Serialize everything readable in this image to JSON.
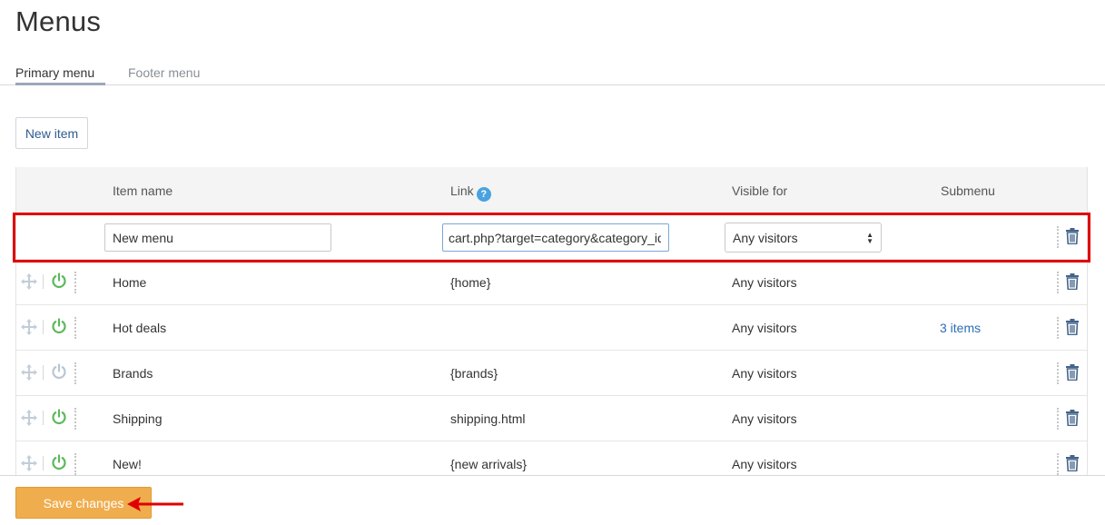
{
  "page": {
    "title": "Menus"
  },
  "tabs": [
    {
      "label": "Primary menu",
      "active": true
    },
    {
      "label": "Footer menu",
      "active": false
    }
  ],
  "toolbar": {
    "new_item_label": "New item"
  },
  "table": {
    "headers": {
      "item_name": "Item name",
      "link": "Link",
      "visible_for": "Visible for",
      "submenu": "Submenu"
    },
    "edit_row": {
      "name_value": "New menu",
      "link_value": "cart.php?target=category&category_id=",
      "visible_for": "Any visitors"
    },
    "rows": [
      {
        "name": "Home",
        "link": "{home}",
        "visible_for": "Any visitors",
        "submenu": "",
        "enabled": true
      },
      {
        "name": "Hot deals",
        "link": "",
        "visible_for": "Any visitors",
        "submenu": "3 items",
        "enabled": true
      },
      {
        "name": "Brands",
        "link": "{brands}",
        "visible_for": "Any visitors",
        "submenu": "",
        "enabled": false
      },
      {
        "name": "Shipping",
        "link": "shipping.html",
        "visible_for": "Any visitors",
        "submenu": "",
        "enabled": true
      },
      {
        "name": "New!",
        "link": "{new arrivals}",
        "visible_for": "Any visitors",
        "submenu": "",
        "enabled": true
      }
    ]
  },
  "footer": {
    "save_label": "Save changes"
  },
  "colors": {
    "accent_orange": "#f0ad4e",
    "link_blue": "#2f6db5",
    "power_on": "#5cb85c",
    "power_off": "#b9c6d3",
    "highlight_red": "#e00000"
  }
}
